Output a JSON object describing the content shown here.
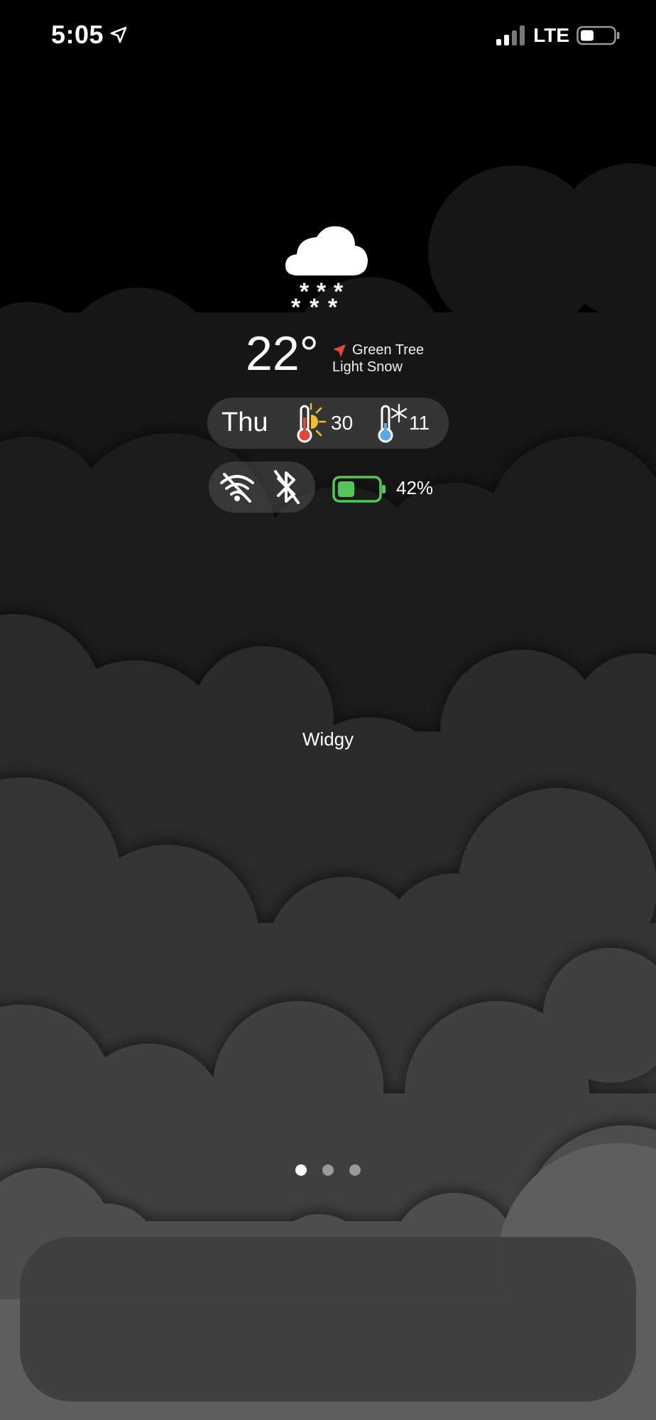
{
  "status_bar": {
    "time": "5:05",
    "network": "LTE",
    "location_icon": "location-arrow-icon",
    "signal_icon": "cellular-signal-icon",
    "battery_icon": "battery-icon"
  },
  "weather_widget": {
    "condition_icon": "cloud-snow-icon",
    "temperature": "22°",
    "location": "Green Tree",
    "condition": "Light Snow",
    "day": "Thu",
    "high": "30",
    "low": "11",
    "high_icon": "thermometer-sun-icon",
    "low_icon": "thermometer-snow-icon",
    "wifi_icon": "wifi-off-icon",
    "bluetooth_icon": "bluetooth-off-icon",
    "battery_level": 0.42,
    "battery_percent": "42%",
    "accent_location": "#e0483a",
    "accent_battery": "#56c55a"
  },
  "app_label": "Widgy",
  "pager": {
    "pages": 3,
    "current": 1
  },
  "dock": {
    "apps": []
  }
}
